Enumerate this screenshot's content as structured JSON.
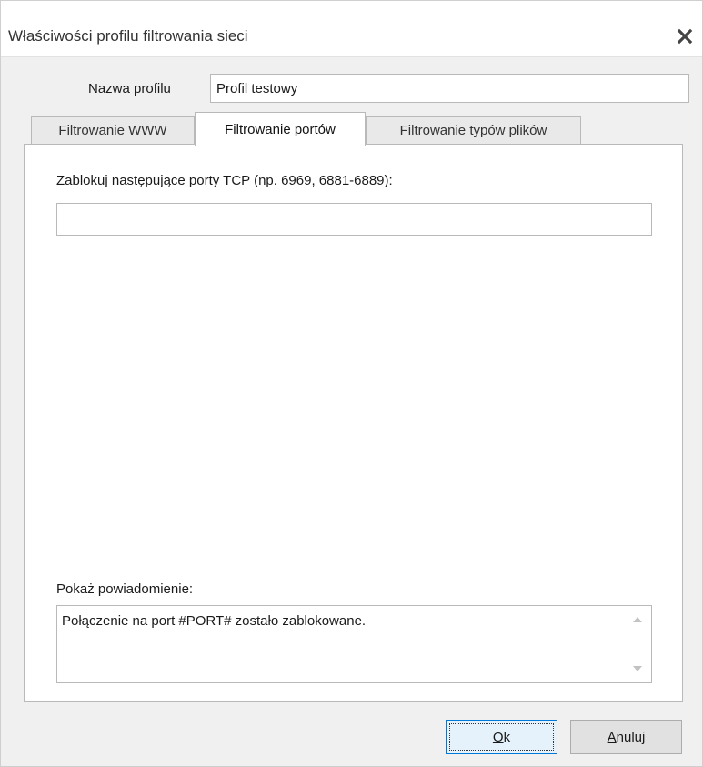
{
  "window": {
    "title": "Właściwości profilu filtrowania sieci",
    "close_icon": "close-icon"
  },
  "profile": {
    "name_label": "Nazwa profilu",
    "name_value": "Profil testowy"
  },
  "tabs": [
    {
      "label": "Filtrowanie WWW",
      "active": false
    },
    {
      "label": "Filtrowanie portów",
      "active": true
    },
    {
      "label": "Filtrowanie typów plików",
      "active": false
    }
  ],
  "ports": {
    "label": "Zablokuj następujące porty TCP (np. 6969, 6881-6889):",
    "value": ""
  },
  "notification": {
    "label": "Pokaż powiadomienie:",
    "value": "Połączenie na port #PORT# zostało zablokowane."
  },
  "buttons": {
    "ok_mnemonic": "O",
    "ok_rest": "k",
    "cancel_mnemonic": "A",
    "cancel_rest": "nuluj"
  },
  "colors": {
    "focus_border": "#0078d7",
    "dialog_bg": "#f0f0f0"
  }
}
